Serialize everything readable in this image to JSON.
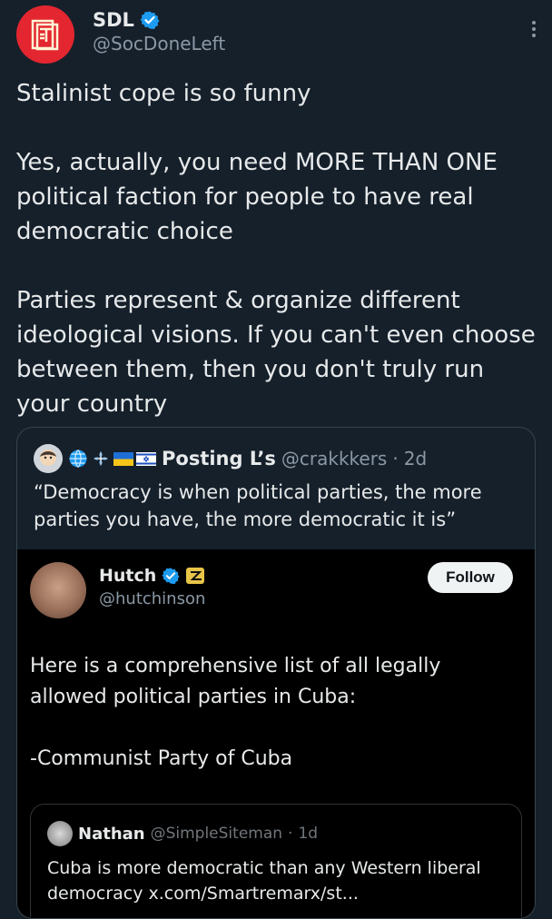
{
  "author": {
    "name": "SDL",
    "handle": "@SocDoneLeft",
    "verified": true,
    "avatar_color": "#e3262f"
  },
  "tweet": {
    "text": "Stalinist cope is so funny\n\nYes, actually, you need MORE THAN ONE political faction for people to have real democratic choice\n\nParties represent & organize different ideological visions. If you can't even choose between them, then you don't truly run your country"
  },
  "quoted": {
    "name": "Posting L’s",
    "handle": "@crakkkers",
    "separator": "·",
    "time": "2d",
    "emoji_icons": [
      "globe-icon",
      "flower-icon",
      "ukraine-flag-icon",
      "israel-flag-icon"
    ],
    "text": "“Democracy is when political parties, the more parties you have, the more democratic it is”"
  },
  "screenshot": {
    "name": "Hutch",
    "handle": "@hutchinson",
    "follow_label": "Follow",
    "text": "Here is a comprehensive list of all legally allowed political parties in Cuba:\n\n-Communist Party of Cuba",
    "nested": {
      "name": "Nathan",
      "handle": "@SimpleSiteman",
      "separator": "·",
      "time": "1d",
      "text": "Cuba is more democratic than any Western liberal democracy x.com/Smartremarx/st..."
    }
  },
  "colors": {
    "background": "#15202b",
    "verified": "#1d9bf0",
    "secondary_text": "#8b98a5"
  }
}
